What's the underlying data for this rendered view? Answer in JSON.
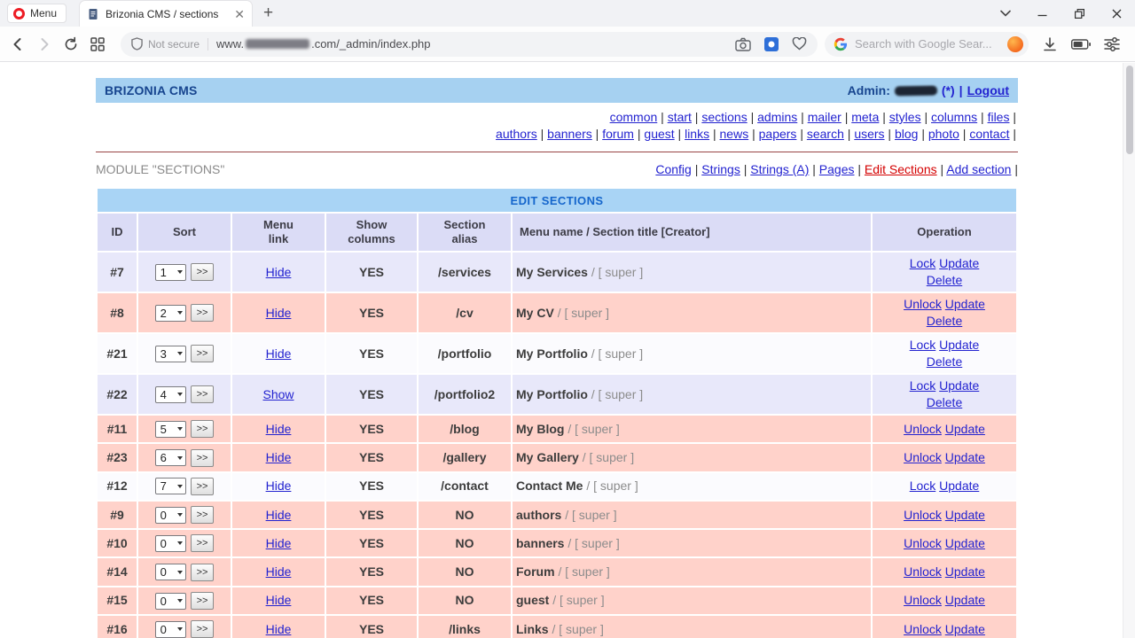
{
  "browser": {
    "menu_label": "Menu",
    "tab": {
      "title": "Brizonia CMS / sections"
    },
    "address": {
      "security": "Not secure",
      "url_prefix": "www.",
      "url_suffix": ".com/_admin/index.php"
    },
    "search": {
      "placeholder": "Search with Google Sear..."
    }
  },
  "header": {
    "brand": "BRIZONIA CMS",
    "admin_label": "Admin:",
    "admin_star": "(*)",
    "separator": "|",
    "logout_label": "Logout"
  },
  "nav": {
    "row1": [
      "common",
      "start",
      "sections",
      "admins",
      "mailer",
      "meta",
      "styles",
      "columns",
      "files"
    ],
    "row2": [
      "authors",
      "banners",
      "forum",
      "guest",
      "links",
      "news",
      "papers",
      "search",
      "users",
      "blog",
      "photo",
      "contact"
    ]
  },
  "module": {
    "title": "MODULE \"SECTIONS\"",
    "links": [
      {
        "label": "Config",
        "active": false
      },
      {
        "label": "Strings",
        "active": false
      },
      {
        "label": "Strings (A)",
        "active": false
      },
      {
        "label": "Pages",
        "active": false
      },
      {
        "label": "Edit Sections",
        "active": true
      },
      {
        "label": "Add section",
        "active": false
      }
    ]
  },
  "table": {
    "title": "EDIT SECTIONS",
    "columns": [
      [
        "ID"
      ],
      [
        "Sort"
      ],
      [
        "Menu",
        "link"
      ],
      [
        "Show",
        "columns"
      ],
      [
        "Section",
        "alias"
      ],
      [
        "Menu name / Section title [Creator]"
      ],
      [
        "Operation"
      ]
    ],
    "sort_button": ">>",
    "rows": [
      {
        "id": "#7",
        "sort": "1",
        "menu_link": "Hide",
        "show_columns": "YES",
        "alias": "/services",
        "name": "My Services",
        "creator": "/ [ super ]",
        "ops": [
          "Lock",
          "Update",
          "Delete"
        ],
        "bg": "lav"
      },
      {
        "id": "#8",
        "sort": "2",
        "menu_link": "Hide",
        "show_columns": "YES",
        "alias": "/cv",
        "name": "My CV",
        "creator": "/ [ super ]",
        "ops": [
          "Unlock",
          "Update",
          "Delete"
        ],
        "bg": "pink"
      },
      {
        "id": "#21",
        "sort": "3",
        "menu_link": "Hide",
        "show_columns": "YES",
        "alias": "/portfolio",
        "name": "My Portfolio",
        "creator": "/ [ super ]",
        "ops": [
          "Lock",
          "Update",
          "Delete"
        ],
        "bg": "white"
      },
      {
        "id": "#22",
        "sort": "4",
        "menu_link": "Show",
        "show_columns": "YES",
        "alias": "/portfolio2",
        "name": "My Portfolio",
        "creator": "/ [ super ]",
        "ops": [
          "Lock",
          "Update",
          "Delete"
        ],
        "bg": "lav"
      },
      {
        "id": "#11",
        "sort": "5",
        "menu_link": "Hide",
        "show_columns": "YES",
        "alias": "/blog",
        "name": "My Blog",
        "creator": "/ [ super ]",
        "ops": [
          "Unlock",
          "Update"
        ],
        "bg": "pink"
      },
      {
        "id": "#23",
        "sort": "6",
        "menu_link": "Hide",
        "show_columns": "YES",
        "alias": "/gallery",
        "name": "My Gallery",
        "creator": "/ [ super ]",
        "ops": [
          "Unlock",
          "Update"
        ],
        "bg": "pink"
      },
      {
        "id": "#12",
        "sort": "7",
        "menu_link": "Hide",
        "show_columns": "YES",
        "alias": "/contact",
        "name": "Contact Me",
        "creator": "/ [ super ]",
        "ops": [
          "Lock",
          "Update"
        ],
        "bg": "white"
      },
      {
        "id": "#9",
        "sort": "0",
        "menu_link": "Hide",
        "show_columns": "YES",
        "alias": "NO",
        "name": "authors",
        "creator": "/ [ super ]",
        "ops": [
          "Unlock",
          "Update"
        ],
        "bg": "pink"
      },
      {
        "id": "#10",
        "sort": "0",
        "menu_link": "Hide",
        "show_columns": "YES",
        "alias": "NO",
        "name": "banners",
        "creator": "/ [ super ]",
        "ops": [
          "Unlock",
          "Update"
        ],
        "bg": "pink"
      },
      {
        "id": "#14",
        "sort": "0",
        "menu_link": "Hide",
        "show_columns": "YES",
        "alias": "NO",
        "name": "Forum",
        "creator": "/ [ super ]",
        "ops": [
          "Unlock",
          "Update"
        ],
        "bg": "pink"
      },
      {
        "id": "#15",
        "sort": "0",
        "menu_link": "Hide",
        "show_columns": "YES",
        "alias": "NO",
        "name": "guest",
        "creator": "/ [ super ]",
        "ops": [
          "Unlock",
          "Update"
        ],
        "bg": "pink"
      },
      {
        "id": "#16",
        "sort": "0",
        "menu_link": "Hide",
        "show_columns": "YES",
        "alias": "/links",
        "name": "Links",
        "creator": "/ [ super ]",
        "ops": [
          "Unlock",
          "Update"
        ],
        "bg": "pink"
      }
    ]
  },
  "colors": {
    "header_bar": "#a6d1f1",
    "table_title_bar": "#a9d4f5",
    "column_header": "#dbdcf6",
    "row_lavender": "#e8e8fa",
    "row_pink": "#ffd2ca",
    "link_blue": "#2323d0",
    "active_red": "#d40000",
    "brand_navy": "#17458f"
  }
}
